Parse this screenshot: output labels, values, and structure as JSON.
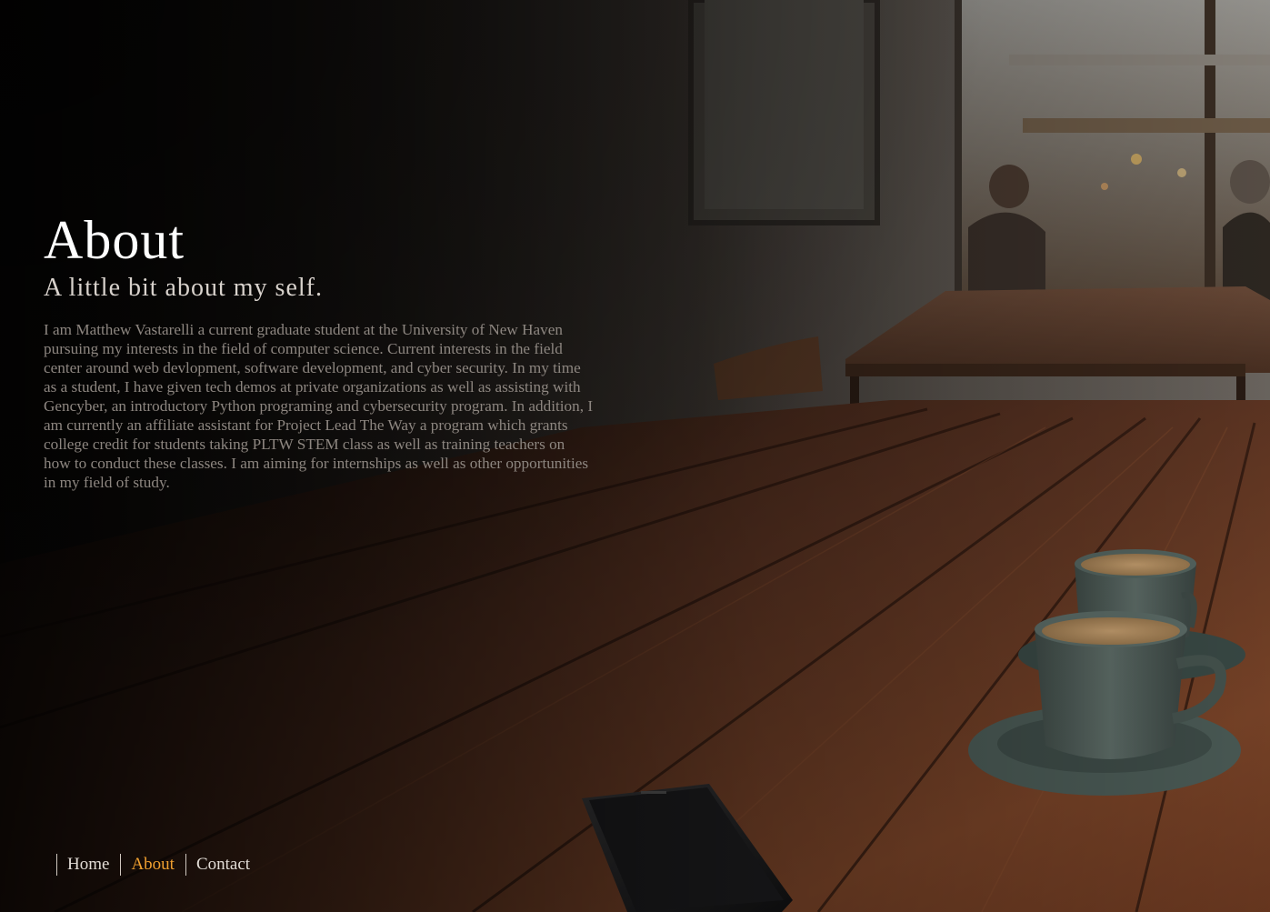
{
  "colors": {
    "accent": "#f0a030",
    "title": "#ffffff",
    "subtitle": "#d8d2cc",
    "body": "#8d8680",
    "nav_text": "#e2dcd6"
  },
  "background": {
    "icons": [
      "cafe-table-photo",
      "coffee-cup",
      "saucer",
      "smartphone"
    ]
  },
  "about": {
    "title": "About",
    "subtitle": "A little bit about my self.",
    "body": "I am Matthew Vastarelli a current graduate student at the University of New Haven pursuing my interests in the field of computer science. Current interests in the field center around web devlopment, software development, and cyber security. In my time as a student, I have given tech demos at private organizations as well as assisting with Gencyber, an introductory Python programing and cybersecurity program. In addition, I am currently an affiliate assistant for Project Lead The Way a program which grants college credit for students taking PLTW STEM class as well as training teachers on how to conduct these classes. I am aiming for internships as well as other opportunities in my field of study."
  },
  "nav": {
    "items": [
      {
        "label": "Home",
        "active": false
      },
      {
        "label": "About",
        "active": true
      },
      {
        "label": "Contact",
        "active": false
      }
    ]
  }
}
